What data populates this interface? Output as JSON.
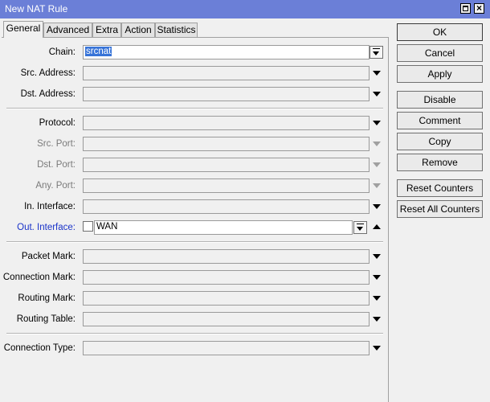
{
  "window": {
    "title": "New NAT Rule"
  },
  "tabs": [
    "General",
    "Advanced",
    "Extra",
    "Action",
    "Statistics"
  ],
  "form": {
    "chain": {
      "label": "Chain:",
      "value": "srcnat"
    },
    "src_address": {
      "label": "Src. Address:"
    },
    "dst_address": {
      "label": "Dst. Address:"
    },
    "protocol": {
      "label": "Protocol:"
    },
    "src_port": {
      "label": "Src. Port:"
    },
    "dst_port": {
      "label": "Dst. Port:"
    },
    "any_port": {
      "label": "Any. Port:"
    },
    "in_interface": {
      "label": "In. Interface:"
    },
    "out_interface": {
      "label": "Out. Interface:",
      "value": "WAN"
    },
    "packet_mark": {
      "label": "Packet Mark:"
    },
    "connection_mark": {
      "label": "Connection Mark:"
    },
    "routing_mark": {
      "label": "Routing Mark:"
    },
    "routing_table": {
      "label": "Routing Table:"
    },
    "connection_type": {
      "label": "Connection Type:"
    }
  },
  "buttons": {
    "ok": "OK",
    "cancel": "Cancel",
    "apply": "Apply",
    "disable": "Disable",
    "comment": "Comment",
    "copy": "Copy",
    "remove": "Remove",
    "reset_counters": "Reset Counters",
    "reset_all_counters": "Reset All Counters"
  },
  "colors": {
    "titlebar": "#6b7fd7",
    "highlight_label": "#1a33c9",
    "selection": "#3874d8"
  }
}
